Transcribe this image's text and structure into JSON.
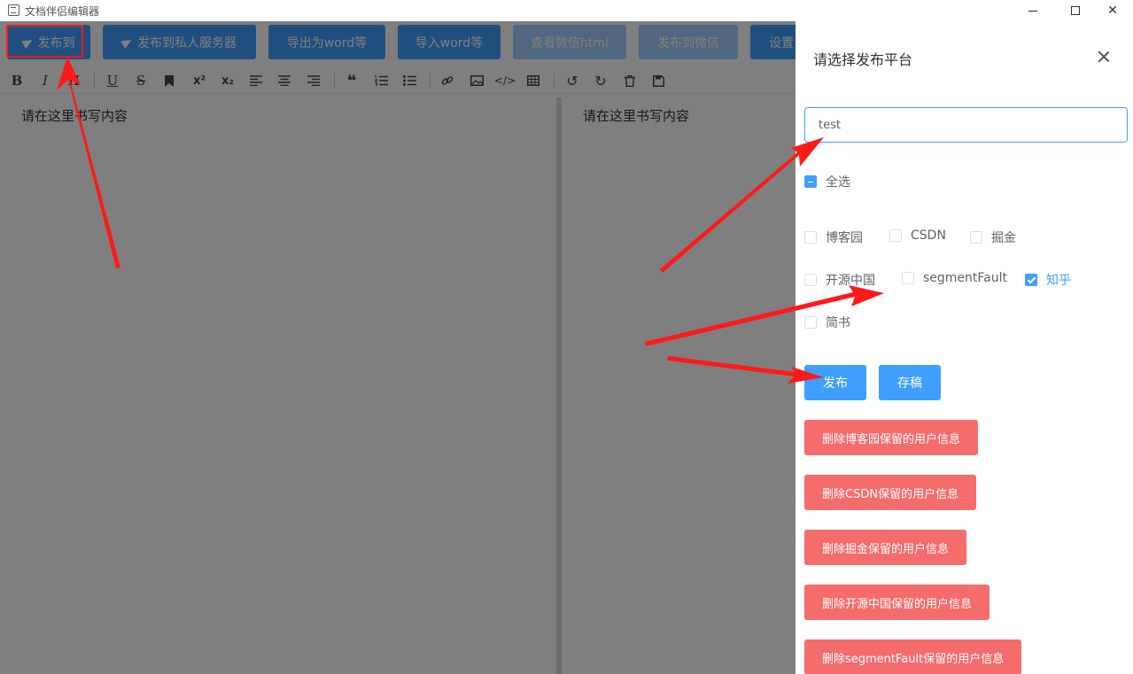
{
  "window": {
    "title": "文档伴侣编辑器"
  },
  "toolbar": {
    "buttons": [
      "发布到",
      "发布到私人服务器",
      "导出为word等",
      "导入word等",
      "查看微信html",
      "发布到微信",
      "设置"
    ]
  },
  "format_icons": [
    "bold-icon",
    "italic-icon",
    "heading-icon",
    "underline-icon",
    "strikethrough-icon",
    "bookmark-icon",
    "superscript-icon",
    "subscript-icon",
    "align-left-icon",
    "align-center-icon",
    "align-right-icon",
    "quote-icon",
    "ordered-list-icon",
    "unordered-list-icon",
    "link-icon",
    "image-icon",
    "code-icon",
    "table-icon",
    "undo-icon",
    "redo-icon",
    "trash-icon",
    "save-icon"
  ],
  "format_glyphs": {
    "bold": "B",
    "italic": "I",
    "heading": "H",
    "underline": "U",
    "strike": "S",
    "sup": "x²",
    "sub": "x₂"
  },
  "editor": {
    "left_placeholder": "请在这里书写内容",
    "right_placeholder": "请在这里书写内容"
  },
  "drawer": {
    "title": "请选择发布平台",
    "input_value": "test",
    "select_all_label": "全选",
    "platforms": [
      {
        "label": "博客园",
        "checked": false
      },
      {
        "label": "CSDN",
        "checked": false
      },
      {
        "label": "掘金",
        "checked": false
      },
      {
        "label": "开源中国",
        "checked": false
      },
      {
        "label": "segmentFault",
        "checked": false
      },
      {
        "label": "知乎",
        "checked": true
      },
      {
        "label": "简书",
        "checked": false
      }
    ],
    "publish_label": "发布",
    "draft_label": "存稿",
    "delete_buttons": [
      "删除博客园保留的用户信息",
      "删除CSDN保留的用户信息",
      "删除掘金保留的用户信息",
      "删除开源中国保留的用户信息",
      "删除segmentFault保留的用户信息"
    ]
  },
  "colors": {
    "primary": "#409eff",
    "primary_light": "#a0cfff",
    "danger": "#f56c6c",
    "annotation": "#ff1a1a"
  }
}
